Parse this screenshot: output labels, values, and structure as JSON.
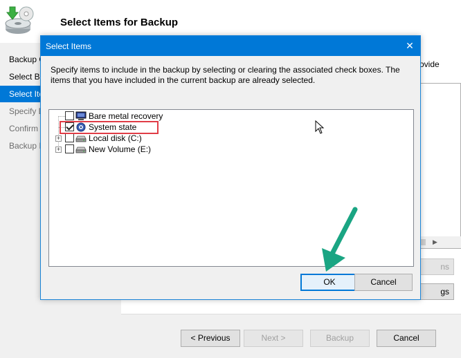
{
  "wizard": {
    "title": "Select Items for Backup",
    "steps": [
      {
        "label": "Backup O",
        "state": "normal"
      },
      {
        "label": "Select Ba",
        "state": "normal"
      },
      {
        "label": "Select Ite",
        "state": "active"
      },
      {
        "label": "Specify D",
        "state": "dim"
      },
      {
        "label": "Confirm",
        "state": "dim"
      },
      {
        "label": "Backup I",
        "state": "dim"
      }
    ],
    "partial_text": "ovide",
    "side_buttons": [
      "ns",
      "gs"
    ],
    "buttons": {
      "previous": "< Previous",
      "next": "Next >",
      "backup": "Backup",
      "cancel": "Cancel"
    }
  },
  "dialog": {
    "title": "Select Items",
    "instructions": "Specify items to include in the backup by selecting or clearing the associated check boxes. The items that you have included in the current backup are already selected.",
    "tree_items": [
      {
        "label": "Bare metal recovery",
        "checked": false,
        "expandable": false,
        "icon": "bare-metal-icon"
      },
      {
        "label": "System state",
        "checked": true,
        "expandable": false,
        "icon": "system-state-icon"
      },
      {
        "label": "Local disk (C:)",
        "checked": false,
        "expandable": true,
        "icon": "drive-icon"
      },
      {
        "label": "New Volume (E:)",
        "checked": false,
        "expandable": true,
        "icon": "drive-icon"
      }
    ],
    "buttons": {
      "ok": "OK",
      "cancel": "Cancel"
    }
  },
  "colors": {
    "accent": "#0078d7",
    "highlight": "#e03c46",
    "arrow": "#1aa583"
  }
}
